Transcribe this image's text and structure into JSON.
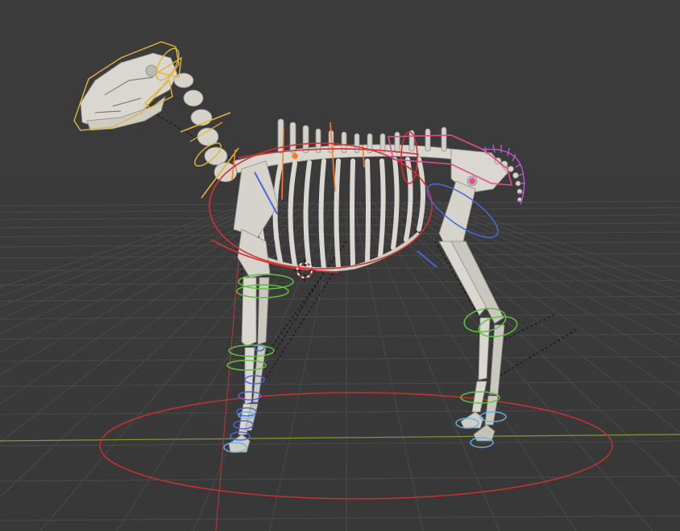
{
  "viewport": {
    "kind": "3d-viewport",
    "mode": "pose",
    "object": "horse-skeleton-rig",
    "colors": {
      "background": "#3c3c3c",
      "grid": "#4a4a4a",
      "axis_x": "#a33a3a",
      "axis_y": "#7f9c3a",
      "bone": "#d9d7d0",
      "head_controls": "#e3b43a",
      "spine_controls": "#ff7a2a",
      "torso_controls": "#d23333",
      "left_leg_controls": "#4a66e0",
      "right_leg_controls": "#5fc23c",
      "tail_controls": "#c25bd9",
      "hip_controls": "#e64b8c",
      "root_control": "#d23333",
      "ik_line": "#1a1a1a"
    },
    "icons": [
      "3d-cursor-icon"
    ]
  }
}
